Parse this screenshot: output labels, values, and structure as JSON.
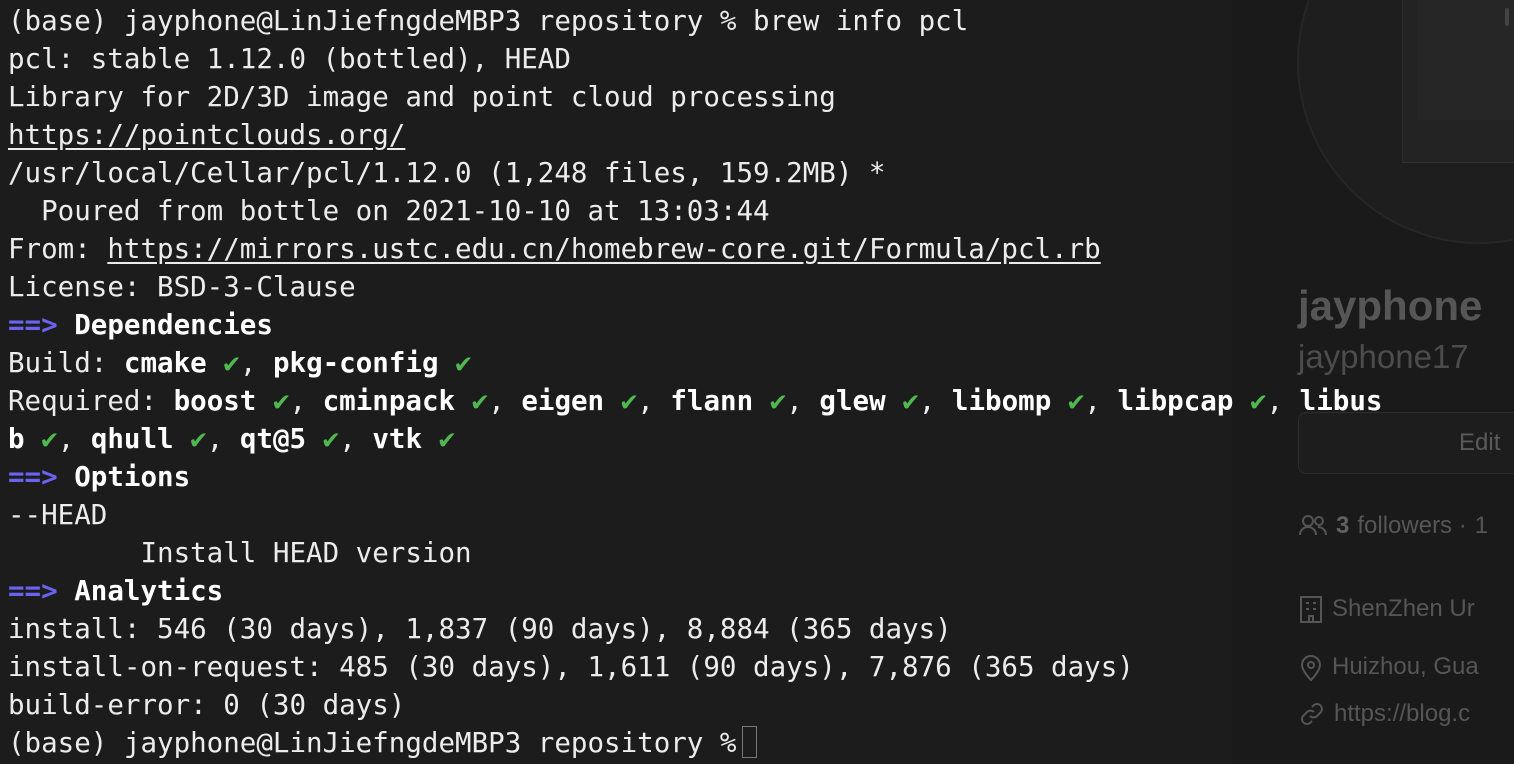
{
  "terminal": {
    "prompt_cmd": "(base) jayphone@LinJiefngdeMBP3 repository % brew info pcl",
    "formula_line": "pcl: stable 1.12.0 (bottled), HEAD",
    "description": "Library for 2D/3D image and point cloud processing",
    "homepage": "https://pointclouds.org/",
    "cellar_line": "/usr/local/Cellar/pcl/1.12.0 (1,248 files, 159.2MB) *",
    "poured_line": "  Poured from bottle on 2021-10-10 at 13:03:44",
    "from_label": "From: ",
    "from_url": "https://mirrors.ustc.edu.cn/homebrew-core.git/Formula/pcl.rb",
    "license_line": "License: BSD-3-Clause",
    "arrow": "==>",
    "section_dependencies": "Dependencies",
    "build_label": "Build: ",
    "build_deps": [
      "cmake",
      "pkg-config"
    ],
    "required_label": "Required: ",
    "required_deps_line1": [
      "boost",
      "cminpack",
      "eigen",
      "flann",
      "glew",
      "libomp",
      "libpcap",
      "libus"
    ],
    "required_deps_line2": [
      "b",
      "qhull",
      "qt@5",
      "vtk"
    ],
    "check_glyph": "✔",
    "section_options": "Options",
    "option_flag": "--HEAD",
    "option_desc": "        Install HEAD version",
    "section_analytics": "Analytics",
    "install_line": "install: 546 (30 days), 1,837 (90 days), 8,884 (365 days)",
    "install_on_request_line": "install-on-request: 485 (30 days), 1,611 (90 days), 7,876 (365 days)",
    "build_error_line": "build-error: 0 (30 days)",
    "prompt_idle": "(base) jayphone@LinJiefngdeMBP3 repository %"
  },
  "background_profile": {
    "name": "jayphone",
    "login": "jayphone17",
    "edit_button": "Edit",
    "followers_count": "3",
    "followers_label": "followers ·",
    "followers_trailing": "1",
    "org": "ShenZhen Ur",
    "location": "Huizhou, Gua",
    "website": "https://blog.c"
  }
}
